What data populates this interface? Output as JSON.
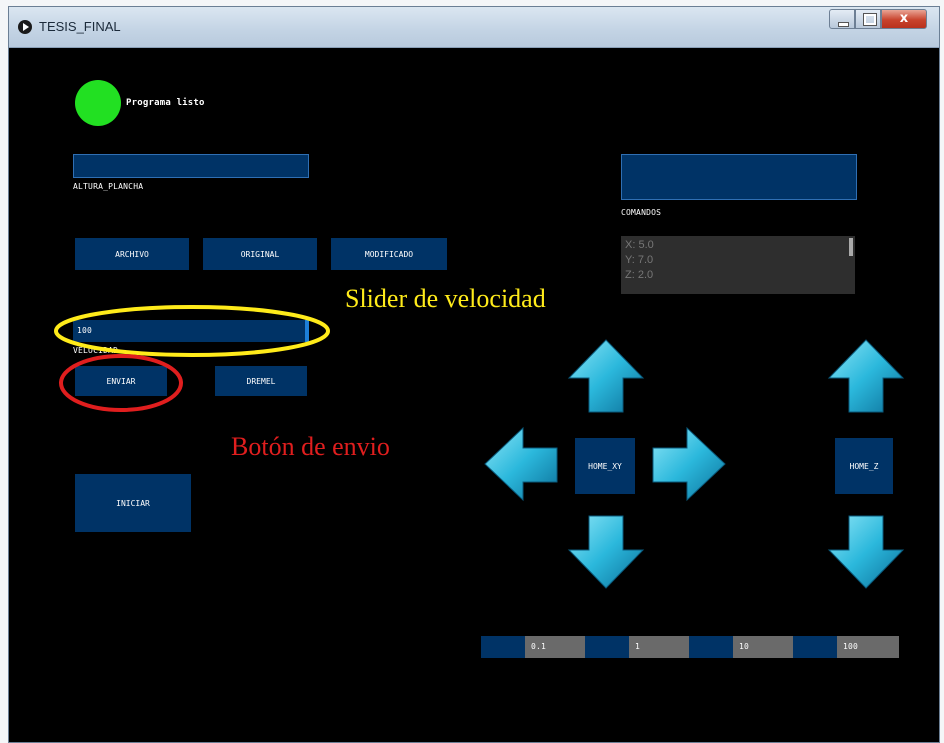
{
  "window": {
    "title": "TESIS_FINAL",
    "close_symbol": "x"
  },
  "status": {
    "label": "Programa listo",
    "indicator_color": "#22e022"
  },
  "altura": {
    "value": "",
    "label": "ALTURA_PLANCHA"
  },
  "comandos": {
    "value": "",
    "label": "COMANDOS"
  },
  "file_buttons": {
    "archivo": "ARCHIVO",
    "original": "ORIGINAL",
    "modificado": "MODIFICADO"
  },
  "slider": {
    "value_text": "100",
    "value": 100,
    "label": "VELOCIDAD"
  },
  "actions": {
    "enviar": "ENVIAR",
    "dremel": "DREMEL",
    "iniciar": "INICIAR"
  },
  "log": {
    "lines": [
      "X: 5.0",
      "Y: 7.0",
      "Z: 2.0"
    ]
  },
  "jog": {
    "home_xy": "HOME_XY",
    "home_z": "HOME_Z"
  },
  "step_sizes": [
    "0.1",
    "1",
    "10",
    "100"
  ],
  "annotations": {
    "slider_note": "Slider de velocidad",
    "button_note": "Botón de envio",
    "slider_color": "#ffeb1a",
    "button_color": "#e01e1e"
  },
  "colors": {
    "button": "#003366",
    "arrow": "#2bb8dc"
  }
}
